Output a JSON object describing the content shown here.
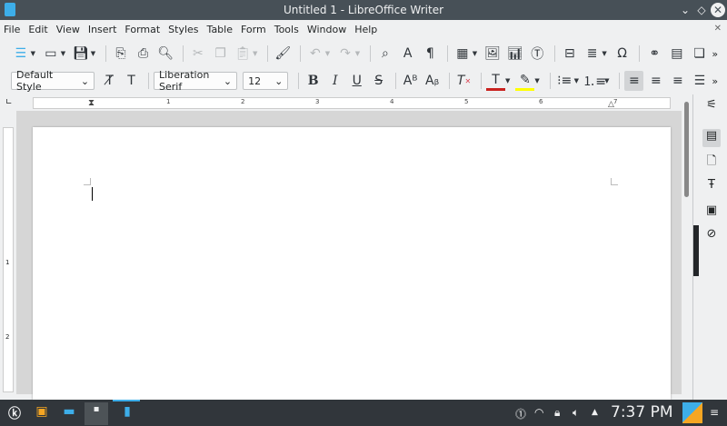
{
  "window": {
    "title": "Untitled 1 - LibreOffice Writer"
  },
  "menu": [
    "File",
    "Edit",
    "View",
    "Insert",
    "Format",
    "Styles",
    "Table",
    "Form",
    "Tools",
    "Window",
    "Help"
  ],
  "format_bar": {
    "paragraph_style": "Default Style",
    "font_name": "Liberation Serif",
    "font_size": "12"
  },
  "ruler": {
    "h_numbers": [
      "1",
      "2",
      "3",
      "4",
      "5",
      "6",
      "7"
    ],
    "v_numbers": [
      "1",
      "2"
    ]
  },
  "colors": {
    "font_color": "#c9211e",
    "highlight_color": "#ffff00",
    "accent": "#3daee9"
  },
  "taskbar": {
    "clock": "7:37 PM"
  }
}
